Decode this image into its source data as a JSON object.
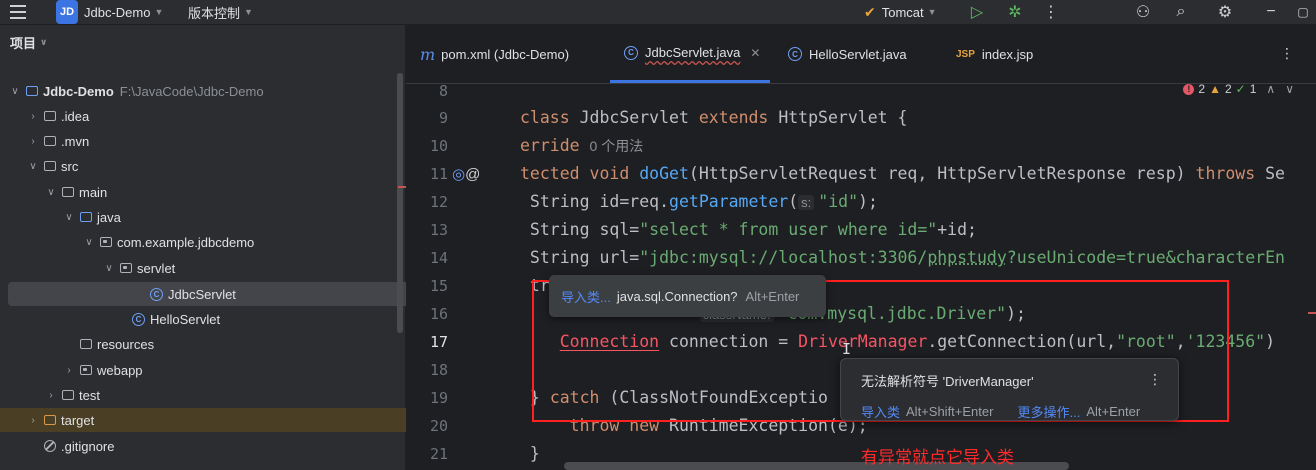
{
  "topbar": {
    "project_badge": "JD",
    "project_name": "Jdbc-Demo",
    "vcs_label": "版本控制",
    "run_config": "Tomcat",
    "colors": {
      "accent": "#3d74e3",
      "run": "#5fb85f",
      "tomcat": "#e8a33d"
    }
  },
  "sidebar": {
    "header": "项目",
    "rows": [
      {
        "label": "Jdbc-Demo",
        "extra": "F:\\JavaCode\\Jdbc-Demo"
      },
      {
        "label": ".idea"
      },
      {
        "label": ".mvn"
      },
      {
        "label": "src"
      },
      {
        "label": "main"
      },
      {
        "label": "java"
      },
      {
        "label": "com.example.jdbcdemo"
      },
      {
        "label": "servlet"
      },
      {
        "label": "JdbcServlet"
      },
      {
        "label": "HelloServlet"
      },
      {
        "label": "resources"
      },
      {
        "label": "webapp"
      },
      {
        "label": "test"
      },
      {
        "label": "target"
      },
      {
        "label": ".gitignore"
      }
    ]
  },
  "tabs": [
    {
      "label": "pom.xml (Jdbc-Demo)",
      "icon": "maven-icon"
    },
    {
      "label": "JdbcServlet.java",
      "icon": "class-icon",
      "active": true
    },
    {
      "label": "HelloServlet.java",
      "icon": "class-icon"
    },
    {
      "label": "index.jsp",
      "icon": "jsp-icon"
    }
  ],
  "inspections": {
    "errors": "2",
    "warnings": "2",
    "typos": "1"
  },
  "editor": {
    "line_numbers": [
      "8",
      "9",
      "10",
      "11",
      "12",
      "13",
      "14",
      "15",
      "16",
      "17",
      "18",
      "19",
      "20",
      "21"
    ],
    "lines": {
      "l9": {
        "kw1": "class ",
        "name": "JdbcServlet ",
        "kw2": "extends ",
        "rest": "HttpServlet {"
      },
      "l10": {
        "kw": "erride",
        "hint": "0 个用法"
      },
      "l11": {
        "kw1": "tected void ",
        "fn": "doGet",
        "rest": "(HttpServletRequest req, HttpServletResponse resp) ",
        "kw2": "throws ",
        "tail": "Se"
      },
      "l12": {
        "a": " String id=req.",
        "fn": "getParameter",
        "b": "(",
        "hint": "s:",
        "str": "\"id\"",
        "c": ");"
      },
      "l13": {
        "a": " String sql=",
        "str": "\"select * from user where id=\"",
        "c": "+id;"
      },
      "l14": {
        "a": " String url=",
        "str1": "\"jdbc:mysql://localhost:3306/",
        "str2": "phpstudy",
        "str3": "?useUnicode=true&characterEn"
      },
      "l15": {
        "a": " tr"
      },
      "l16": {
        "a": "     ",
        "hint": "className:",
        "str": "\"com.mysql.jdbc.Driver\"",
        "c": ");"
      },
      "l17": {
        "a": "    ",
        "err": "Connection",
        "b": " connection = ",
        "err2": "DriverManager",
        "c": ".getConnection(url,",
        "str1": "\"root\"",
        "d": ",",
        "str2": "'123456\"",
        "e": ")"
      },
      "l19": {
        "a": " } ",
        "kw": "catch ",
        "b": "(ClassNotFoundExceptio"
      },
      "l20": {
        "a": "     ",
        "kw1": "throw new ",
        "b": "RuntimeException(e);"
      },
      "l21": {
        "a": " }"
      }
    }
  },
  "popup_import": {
    "action": "导入类...",
    "fqcn": "java.sql.Connection?",
    "shortcut": "Alt+Enter"
  },
  "popup_error": {
    "message": "无法解析符号 'DriverManager'",
    "action1": "导入类",
    "shortcut1": "Alt+Shift+Enter",
    "action2": "更多操作...",
    "shortcut2": "Alt+Enter"
  },
  "annotation": "有异常就点它导入类"
}
